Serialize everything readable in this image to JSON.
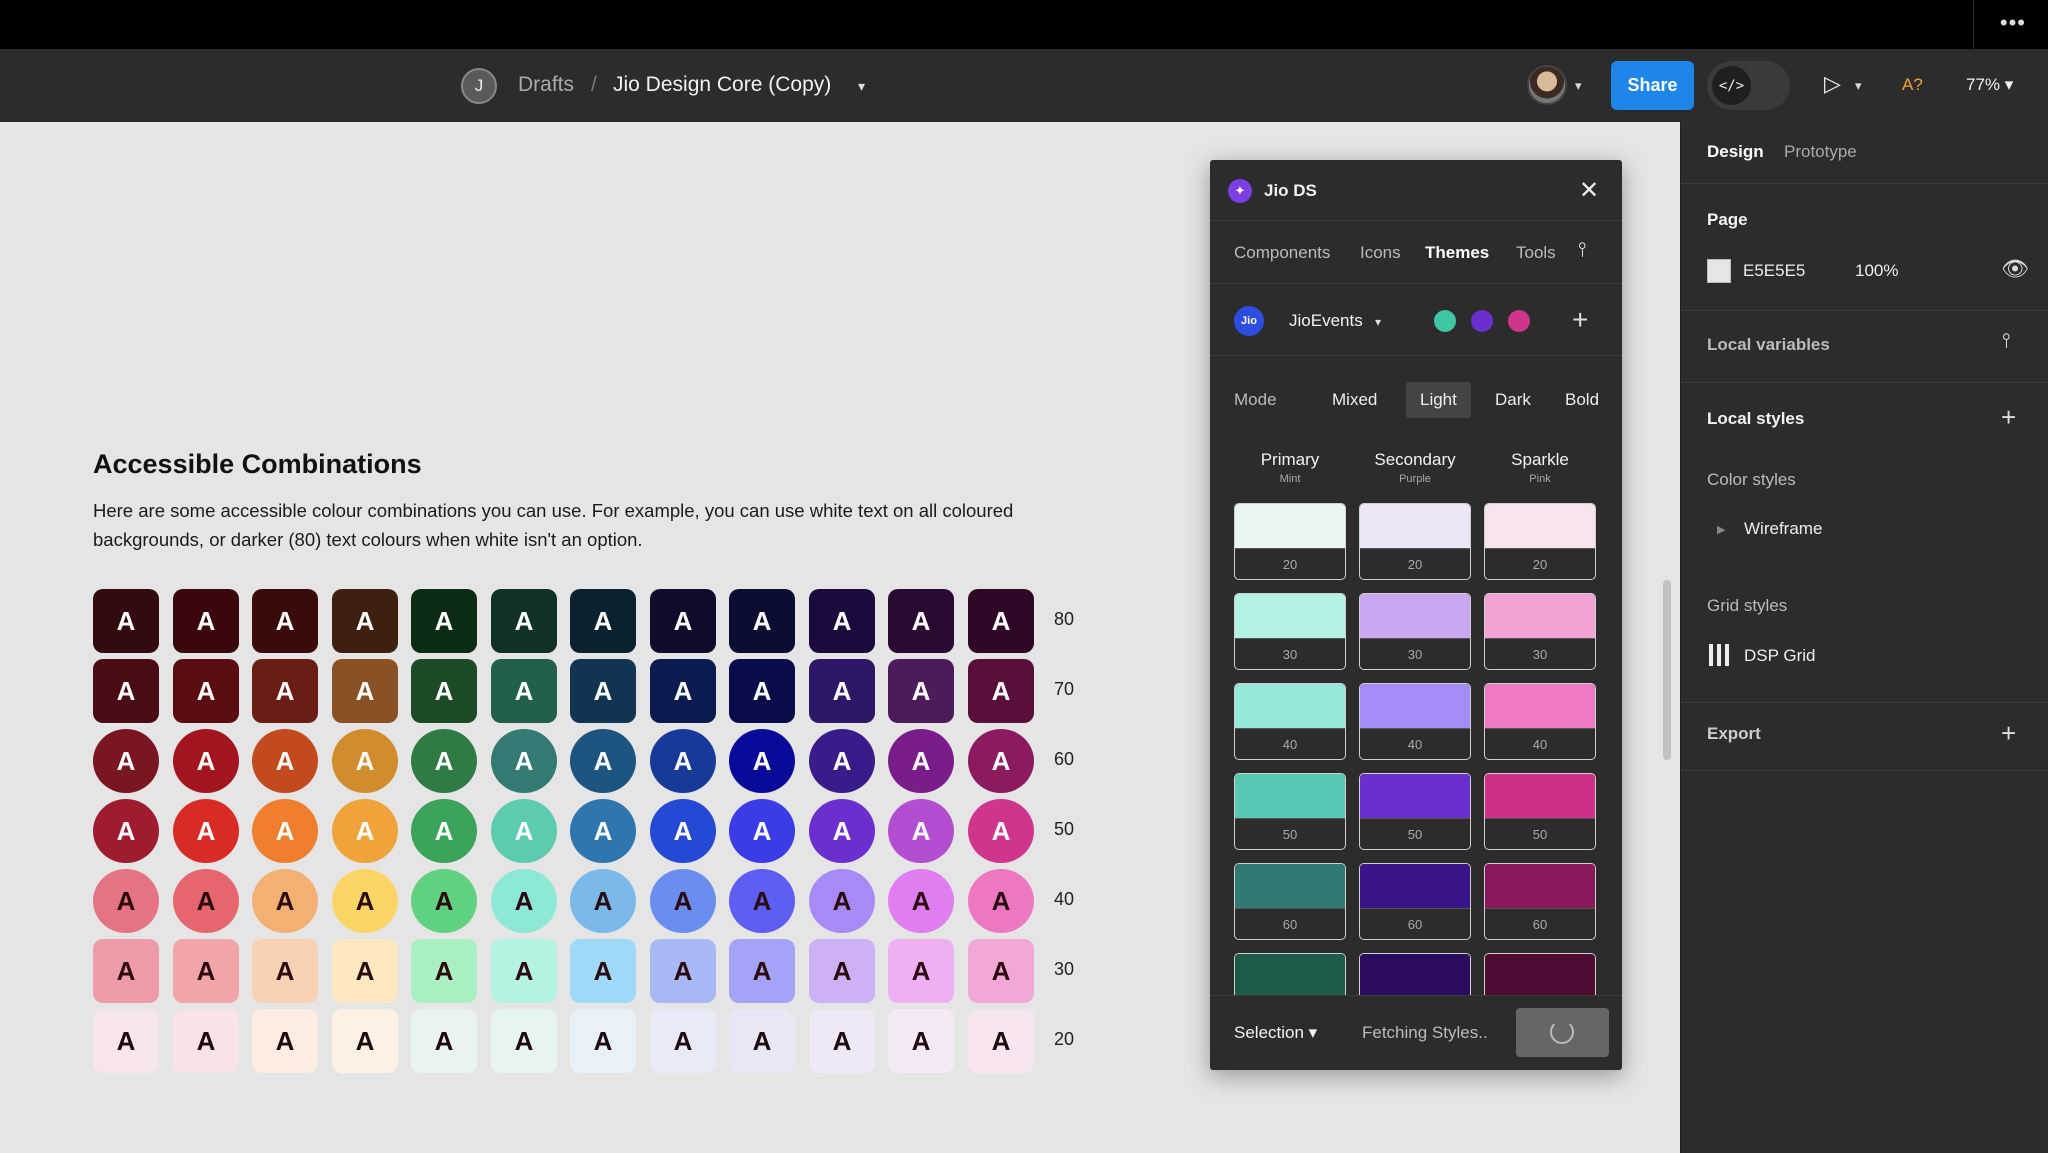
{
  "colors": {
    "accent": "#1e86e8",
    "canvas": "#E5E5E5",
    "panel": "#2c2c2c"
  },
  "toolbar": {
    "user_initial": "J",
    "breadcrumb_drafts": "Drafts",
    "breadcrumb_sep": "/",
    "file_name": "Jio Design Core (Copy)",
    "share_label": "Share",
    "dev_mode_icon": "</>",
    "a_question": "A?",
    "zoom": "77%"
  },
  "canvas": {
    "heading": "Accessible Combinations",
    "description": "Here are some accessible colour combinations you can use. For example, you can use white text on all coloured backgrounds, or darker (80) text colours when white isn't an option.",
    "glyph": "A",
    "rows": [
      {
        "level": "80",
        "text": "#ffffff",
        "shape": "rounded",
        "colors": [
          "#330a0f",
          "#3a070b",
          "#3b0a0a",
          "#3d2010",
          "#0c2b14",
          "#123127",
          "#0b2130",
          "#0f0b2b",
          "#0c0d33",
          "#1a0a3e",
          "#2a0a32",
          "#2e0825"
        ]
      },
      {
        "level": "70",
        "text": "#ffffff",
        "shape": "rounded",
        "colors": [
          "#4a0c14",
          "#5b0d12",
          "#6a1d12",
          "#8a5224",
          "#1b4a26",
          "#22604d",
          "#103452",
          "#0b1a4f",
          "#0a0b4a",
          "#2e1766",
          "#4d1b5c",
          "#5a0f3a"
        ]
      },
      {
        "level": "60",
        "text": "#ffffff",
        "shape": "circle",
        "colors": [
          "#7a1522",
          "#a3151f",
          "#c24a1c",
          "#d18c2e",
          "#2f7a45",
          "#327a72",
          "#1e5480",
          "#173a9a",
          "#0a0a9a",
          "#3a1b8a",
          "#7a1c8a",
          "#8b1a5e"
        ]
      },
      {
        "level": "50",
        "text": "#ffffff",
        "shape": "circle",
        "colors": [
          "#9e1b30",
          "#d92b26",
          "#ef7f2c",
          "#f0a33a",
          "#3ba35a",
          "#5ccbb0",
          "#2d76b0",
          "#2549d4",
          "#3b3be8",
          "#6b2fd0",
          "#b34ed0",
          "#d0358d"
        ]
      },
      {
        "level": "40",
        "text": "#2a0a10",
        "shape": "circle",
        "colors": [
          "#e57383",
          "#e6666e",
          "#f4b073",
          "#fbd667",
          "#5fd180",
          "#8ee8d6",
          "#7ab9ea",
          "#6a8ef0",
          "#5e5ef5",
          "#a78af5",
          "#e07df0",
          "#ee78c0"
        ]
      },
      {
        "level": "30",
        "text": "#2a0a10",
        "shape": "rounded",
        "colors": [
          "#ef9aa7",
          "#f2a5a8",
          "#f8d1b3",
          "#fde8bf",
          "#a9efc2",
          "#b4f2e4",
          "#9ed9f8",
          "#a8b8f5",
          "#a3a3f7",
          "#cdb1f5",
          "#efb0f3",
          "#f2a8d4"
        ]
      },
      {
        "level": "20",
        "text": "#1e0a10",
        "shape": "rounded",
        "colors": [
          "#f7e6e9",
          "#f8e4e5",
          "#fcece2",
          "#fdf1e4",
          "#e9f4ee",
          "#e7f5f1",
          "#e8f1f7",
          "#e8ebf7",
          "#e7e7f5",
          "#efe9f7",
          "#f6e9f6",
          "#f7e6ef"
        ]
      }
    ]
  },
  "plugin": {
    "title": "Jio DS",
    "tabs": [
      "Components",
      "Icons",
      "Themes",
      "Tools"
    ],
    "active_tab": "Themes",
    "brand_logo": "Jio",
    "brand_name": "JioEvents",
    "brand_dots": [
      "#3fc6a5",
      "#6b2fd0",
      "#d0358d"
    ],
    "mode_label": "Mode",
    "modes": [
      "Mixed",
      "Light",
      "Dark",
      "Bold"
    ],
    "active_mode": "Light",
    "columns": [
      {
        "name": "Primary",
        "sub": "Mint"
      },
      {
        "name": "Secondary",
        "sub": "Purple"
      },
      {
        "name": "Sparkle",
        "sub": "Pink"
      }
    ],
    "swatch_rows": [
      {
        "level": "20",
        "colors": [
          "#e9f6f3",
          "#ede6f7",
          "#f8e4ef"
        ]
      },
      {
        "level": "30",
        "colors": [
          "#b3f2e5",
          "#c8a8f2",
          "#f3a3d3"
        ]
      },
      {
        "level": "40",
        "colors": [
          "#96e8da",
          "#a58bf5",
          "#ef79c5"
        ]
      },
      {
        "level": "50",
        "colors": [
          "#57c9b2",
          "#6b2fd0",
          "#cf2f88"
        ]
      },
      {
        "level": "60",
        "colors": [
          "#317a72",
          "#3a1589",
          "#8a1a5c"
        ]
      },
      {
        "level": "",
        "colors": [
          "#1e5a4a",
          "#2a0d5e",
          "#4e0c32"
        ]
      }
    ],
    "footer_selection": "Selection",
    "footer_status": "Fetching Styles.."
  },
  "right_panel": {
    "tabs": [
      "Design",
      "Prototype"
    ],
    "page_section": "Page",
    "page_color": "E5E5E5",
    "page_opacity": "100%",
    "local_variables": "Local variables",
    "local_styles": "Local styles",
    "color_styles": "Color styles",
    "wireframe": "Wireframe",
    "grid_styles": "Grid styles",
    "dsp_grid": "DSP Grid",
    "export": "Export"
  }
}
